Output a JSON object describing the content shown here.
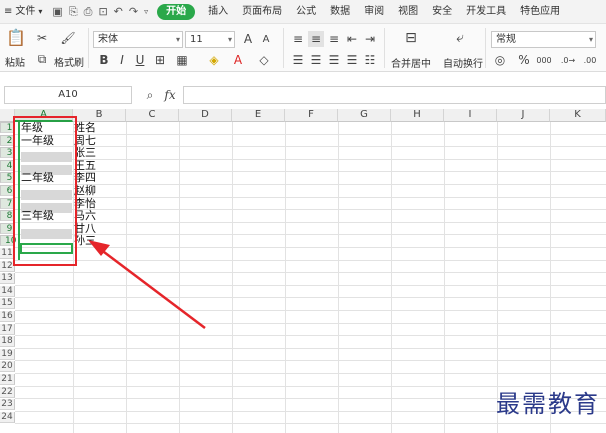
{
  "menubar": {
    "file_label": "文件",
    "tabs": [
      "开始",
      "插入",
      "页面布局",
      "公式",
      "数据",
      "审阅",
      "视图",
      "安全",
      "开发工具",
      "特色应用"
    ]
  },
  "ribbon": {
    "paste_label": "粘贴",
    "cut_label": "",
    "format_painter_label": "格式刷",
    "font_name": "宋体",
    "font_size": "11",
    "merge_label": "合并居中",
    "wrap_label": "自动换行",
    "number_format": "常规",
    "bold": "B",
    "italic": "I",
    "underline": "U",
    "grow": "A",
    "shrink": "A",
    "percent": "%",
    "thousands": "000"
  },
  "formula_bar": {
    "name_box": "A10",
    "fx_label": "fx",
    "content": ""
  },
  "sheet": {
    "columns": [
      "A",
      "B",
      "C",
      "D",
      "E",
      "F",
      "G",
      "H",
      "I",
      "J",
      "K"
    ],
    "rows": [
      "1",
      "2",
      "3",
      "4",
      "5",
      "6",
      "7",
      "8",
      "9",
      "10",
      "11",
      "12",
      "13",
      "14",
      "15",
      "16",
      "17",
      "18",
      "19",
      "20",
      "21",
      "22",
      "23",
      "24"
    ],
    "colA": [
      "年级",
      "一年级",
      "",
      "",
      "二年级",
      "",
      "",
      "三年级",
      "",
      ""
    ],
    "colB": [
      "姓名",
      "周七",
      "张三",
      "王五",
      "李四",
      "赵柳",
      "李怡",
      "马六",
      "甘八",
      "孙三"
    ]
  },
  "watermark": "最需教育"
}
